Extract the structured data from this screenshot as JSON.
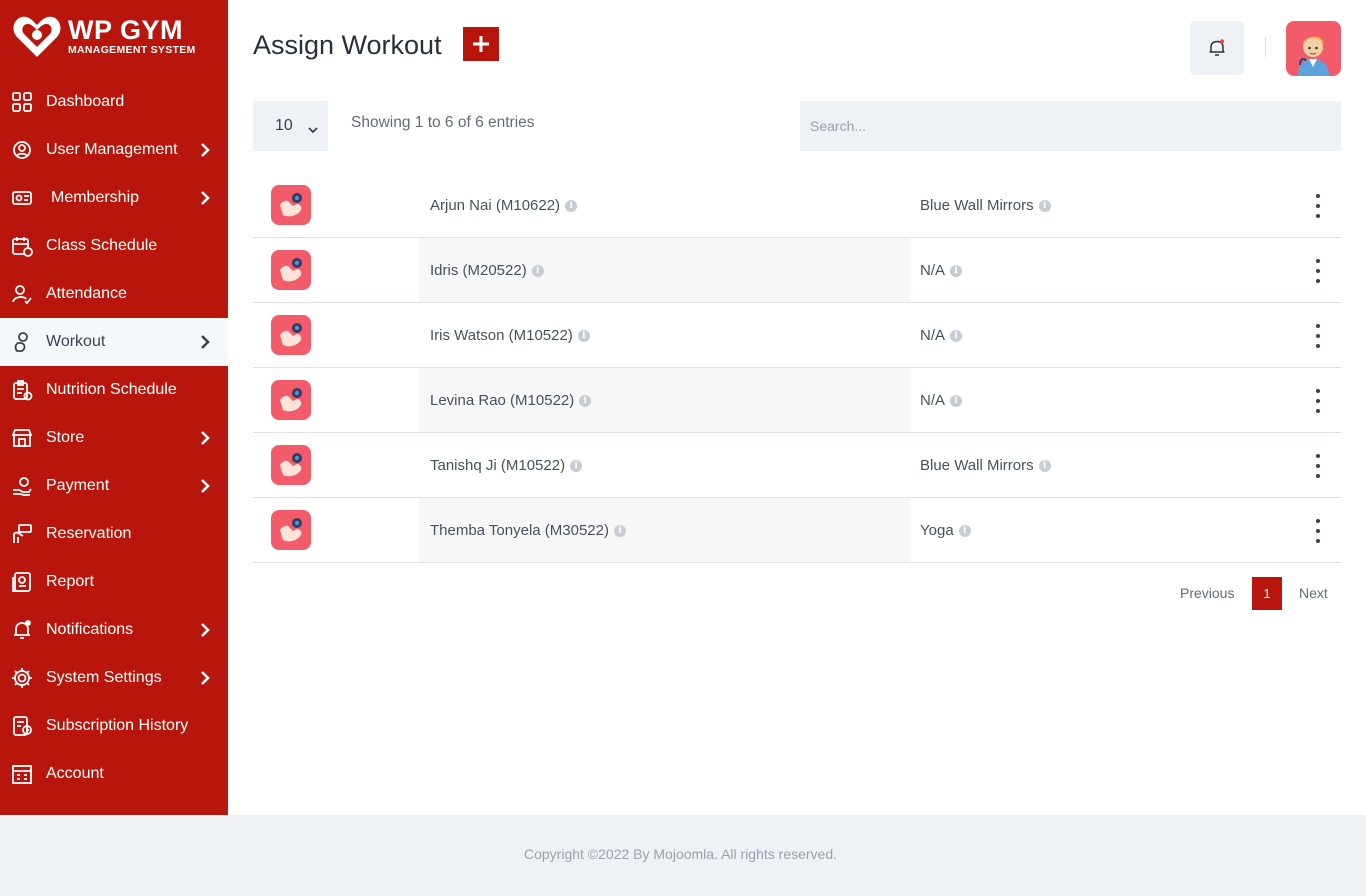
{
  "brand": {
    "title": "WP GYM",
    "subtitle": "MANAGEMENT SYSTEM",
    "accent_color": "#b8160c"
  },
  "sidebar": {
    "items": [
      {
        "label": "Dashboard",
        "icon": "dashboard-grid-icon",
        "has_submenu": false,
        "active": false
      },
      {
        "label": "User Management",
        "icon": "users-gear-icon",
        "has_submenu": true,
        "active": false
      },
      {
        "label": "Membership",
        "icon": "membership-card-icon",
        "has_submenu": true,
        "active": false
      },
      {
        "label": "Class Schedule",
        "icon": "calendar-icon",
        "has_submenu": false,
        "active": false
      },
      {
        "label": "Attendance",
        "icon": "user-check-icon",
        "has_submenu": false,
        "active": false
      },
      {
        "label": "Workout",
        "icon": "workout-icon",
        "has_submenu": true,
        "active": true
      },
      {
        "label": "Nutrition Schedule",
        "icon": "clipboard-icon",
        "has_submenu": false,
        "active": false
      },
      {
        "label": "Store",
        "icon": "store-icon",
        "has_submenu": true,
        "active": false
      },
      {
        "label": "Payment",
        "icon": "payment-hand-icon",
        "has_submenu": true,
        "active": false
      },
      {
        "label": "Reservation",
        "icon": "reservation-icon",
        "has_submenu": false,
        "active": false
      },
      {
        "label": "Report",
        "icon": "report-icon",
        "has_submenu": false,
        "active": false
      },
      {
        "label": "Notifications",
        "icon": "bell-icon",
        "has_submenu": true,
        "active": false
      },
      {
        "label": "System Settings",
        "icon": "gear-icon",
        "has_submenu": true,
        "active": false
      },
      {
        "label": "Subscription History",
        "icon": "history-doc-icon",
        "has_submenu": false,
        "active": false
      },
      {
        "label": "Account",
        "icon": "account-icon",
        "has_submenu": false,
        "active": false
      }
    ]
  },
  "header": {
    "title": "Assign Workout",
    "add_icon": "plus-icon",
    "bell_icon": "bell-icon",
    "avatar_icon": "user-avatar-icon"
  },
  "controls": {
    "page_length": "10",
    "info": "Showing 1 to 6 of 6 entries",
    "search_placeholder": "Search..."
  },
  "table": {
    "rows": [
      {
        "member": "Arjun Nai (M10622)",
        "workout": "Blue Wall Mirrors"
      },
      {
        "member": "Idris (M20522)",
        "workout": "N/A"
      },
      {
        "member": "Iris Watson (M10522)",
        "workout": "N/A"
      },
      {
        "member": "Levina Rao (M10522)",
        "workout": "N/A"
      },
      {
        "member": "Tanishq Ji (M10522)",
        "workout": "Blue Wall Mirrors"
      },
      {
        "member": "Themba Tonyela (M30522)",
        "workout": "Yoga"
      }
    ]
  },
  "pagination": {
    "previous": "Previous",
    "current": "1",
    "next": "Next"
  },
  "footer": {
    "copyright": "Copyright ©2022 By Mojoomla. All rights reserved."
  }
}
